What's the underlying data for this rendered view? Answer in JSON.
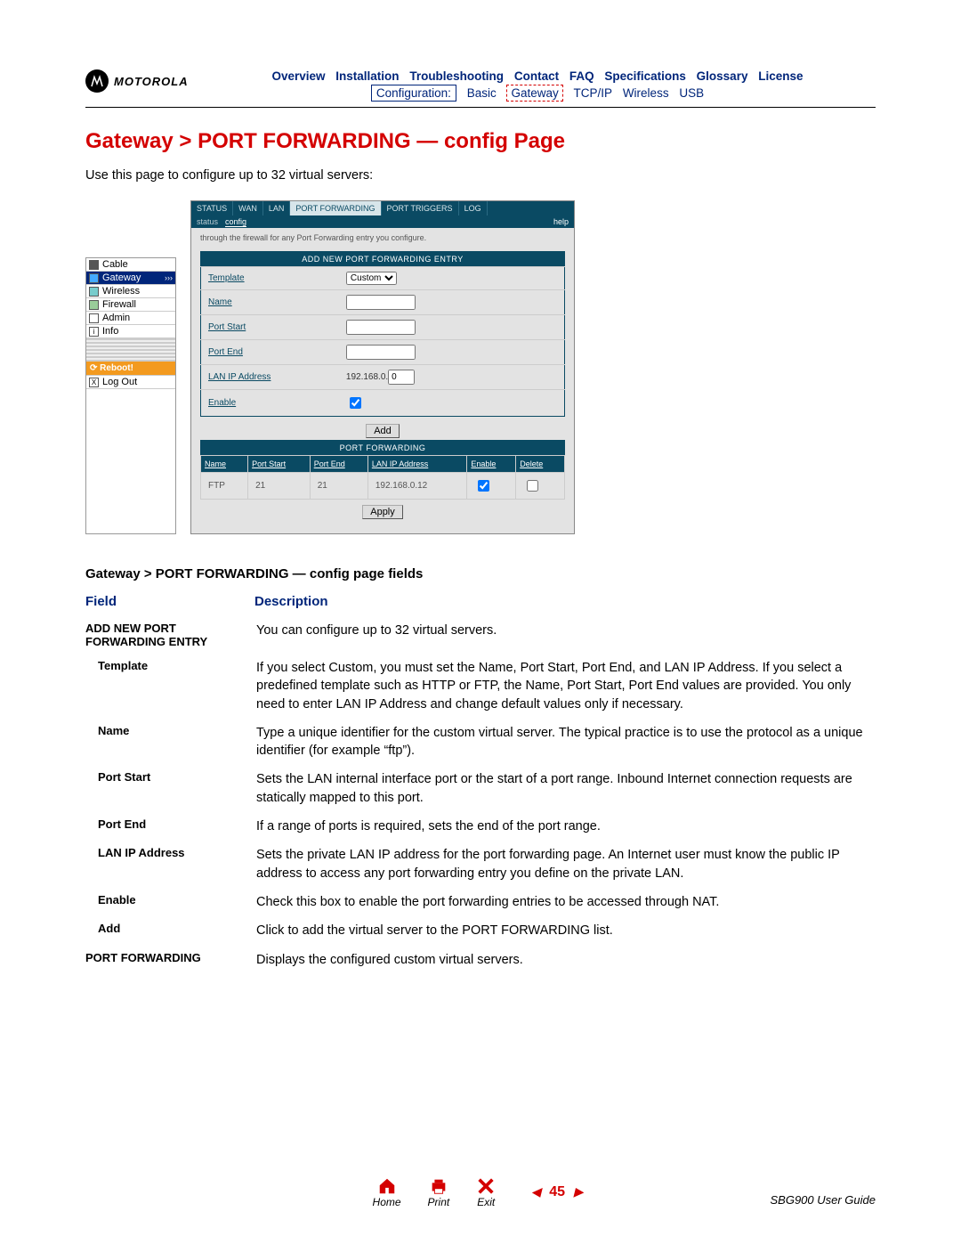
{
  "header": {
    "brand": "MOTOROLA",
    "nav": {
      "overview": "Overview",
      "installation": "Installation",
      "troubleshooting": "Troubleshooting",
      "contact": "Contact",
      "faq": "FAQ",
      "specifications": "Specifications",
      "glossary": "Glossary",
      "license": "License"
    },
    "subnav": {
      "configuration": "Configuration:",
      "basic": "Basic",
      "gateway": "Gateway",
      "tcpip": "TCP/IP",
      "wireless": "Wireless",
      "usb": "USB"
    }
  },
  "title": "Gateway > PORT FORWARDING — config Page",
  "intro": "Use this page to configure up to 32 virtual servers:",
  "side_menu": {
    "cable": "Cable",
    "gateway": "Gateway",
    "wireless": "Wireless",
    "firewall": "Firewall",
    "admin": "Admin",
    "info": "Info",
    "reboot": "Reboot!",
    "logout": "Log Out"
  },
  "panel": {
    "tabs": {
      "status": "STATUS",
      "wan": "WAN",
      "lan": "LAN",
      "portfwd": "PORT FORWARDING",
      "porttriggers": "PORT TRIGGERS",
      "log": "LOG"
    },
    "sub": {
      "status": "status",
      "config": "config",
      "help": "help"
    },
    "note": "through the firewall for any Port Forwarding entry you configure.",
    "add_header": "ADD NEW PORT FORWARDING ENTRY",
    "labels": {
      "template": "Template",
      "name": "Name",
      "portstart": "Port Start",
      "portend": "Port End",
      "lanip": "LAN IP Address",
      "enable": "Enable"
    },
    "values": {
      "template_sel": "Custom",
      "lanip_prefix": "192.168.0.",
      "lanip_val": "0"
    },
    "add_btn": "Add",
    "pf_header": "PORT FORWARDING",
    "pf_cols": {
      "name": "Name",
      "portstart": "Port Start",
      "portend": "Port End",
      "lanip": "LAN IP Address",
      "enable": "Enable",
      "delete": "Delete"
    },
    "pf_row": {
      "name": "FTP",
      "portstart": "21",
      "portend": "21",
      "lanip": "192.168.0.12"
    },
    "apply_btn": "Apply"
  },
  "fields_title": "Gateway > PORT FORWARDING — config page fields",
  "table_headers": {
    "field": "Field",
    "description": "Description"
  },
  "rows": {
    "addnew": {
      "label": "ADD NEW PORT FORWARDING ENTRY",
      "desc": "You can configure up to 32 virtual servers."
    },
    "template": {
      "label": "Template",
      "desc": "If you select Custom, you must set the Name, Port Start, Port End, and LAN IP Address. If you select a predefined template such as HTTP or FTP, the Name, Port Start, Port End values are provided. You only need to enter LAN IP Address and change default values only if necessary."
    },
    "name": {
      "label": "Name",
      "desc": "Type a unique identifier for the custom virtual server. The typical practice is to use the protocol as a unique identifier (for example “ftp”)."
    },
    "portstart": {
      "label": "Port Start",
      "desc": "Sets the LAN internal interface port or the start of a port range. Inbound Internet connection requests are statically mapped to this port."
    },
    "portend": {
      "label": "Port End",
      "desc": "If a range of ports is required, sets the end of the port range."
    },
    "lanip": {
      "label": "LAN IP Address",
      "desc": "Sets the private LAN IP address for the port forwarding page. An Internet user must know the public IP address to access any port forwarding entry you define on the private LAN."
    },
    "enable": {
      "label": "Enable",
      "desc": "Check this box to enable the port forwarding entries to be accessed through NAT."
    },
    "add": {
      "label": "Add",
      "desc": "Click to add the virtual server to the PORT FORWARDING list."
    },
    "pf": {
      "label": "PORT FORWARDING",
      "desc": "Displays the configured custom virtual servers."
    }
  },
  "footer": {
    "home": "Home",
    "print": "Print",
    "exit": "Exit",
    "page": "45",
    "guide": "SBG900 User Guide"
  }
}
